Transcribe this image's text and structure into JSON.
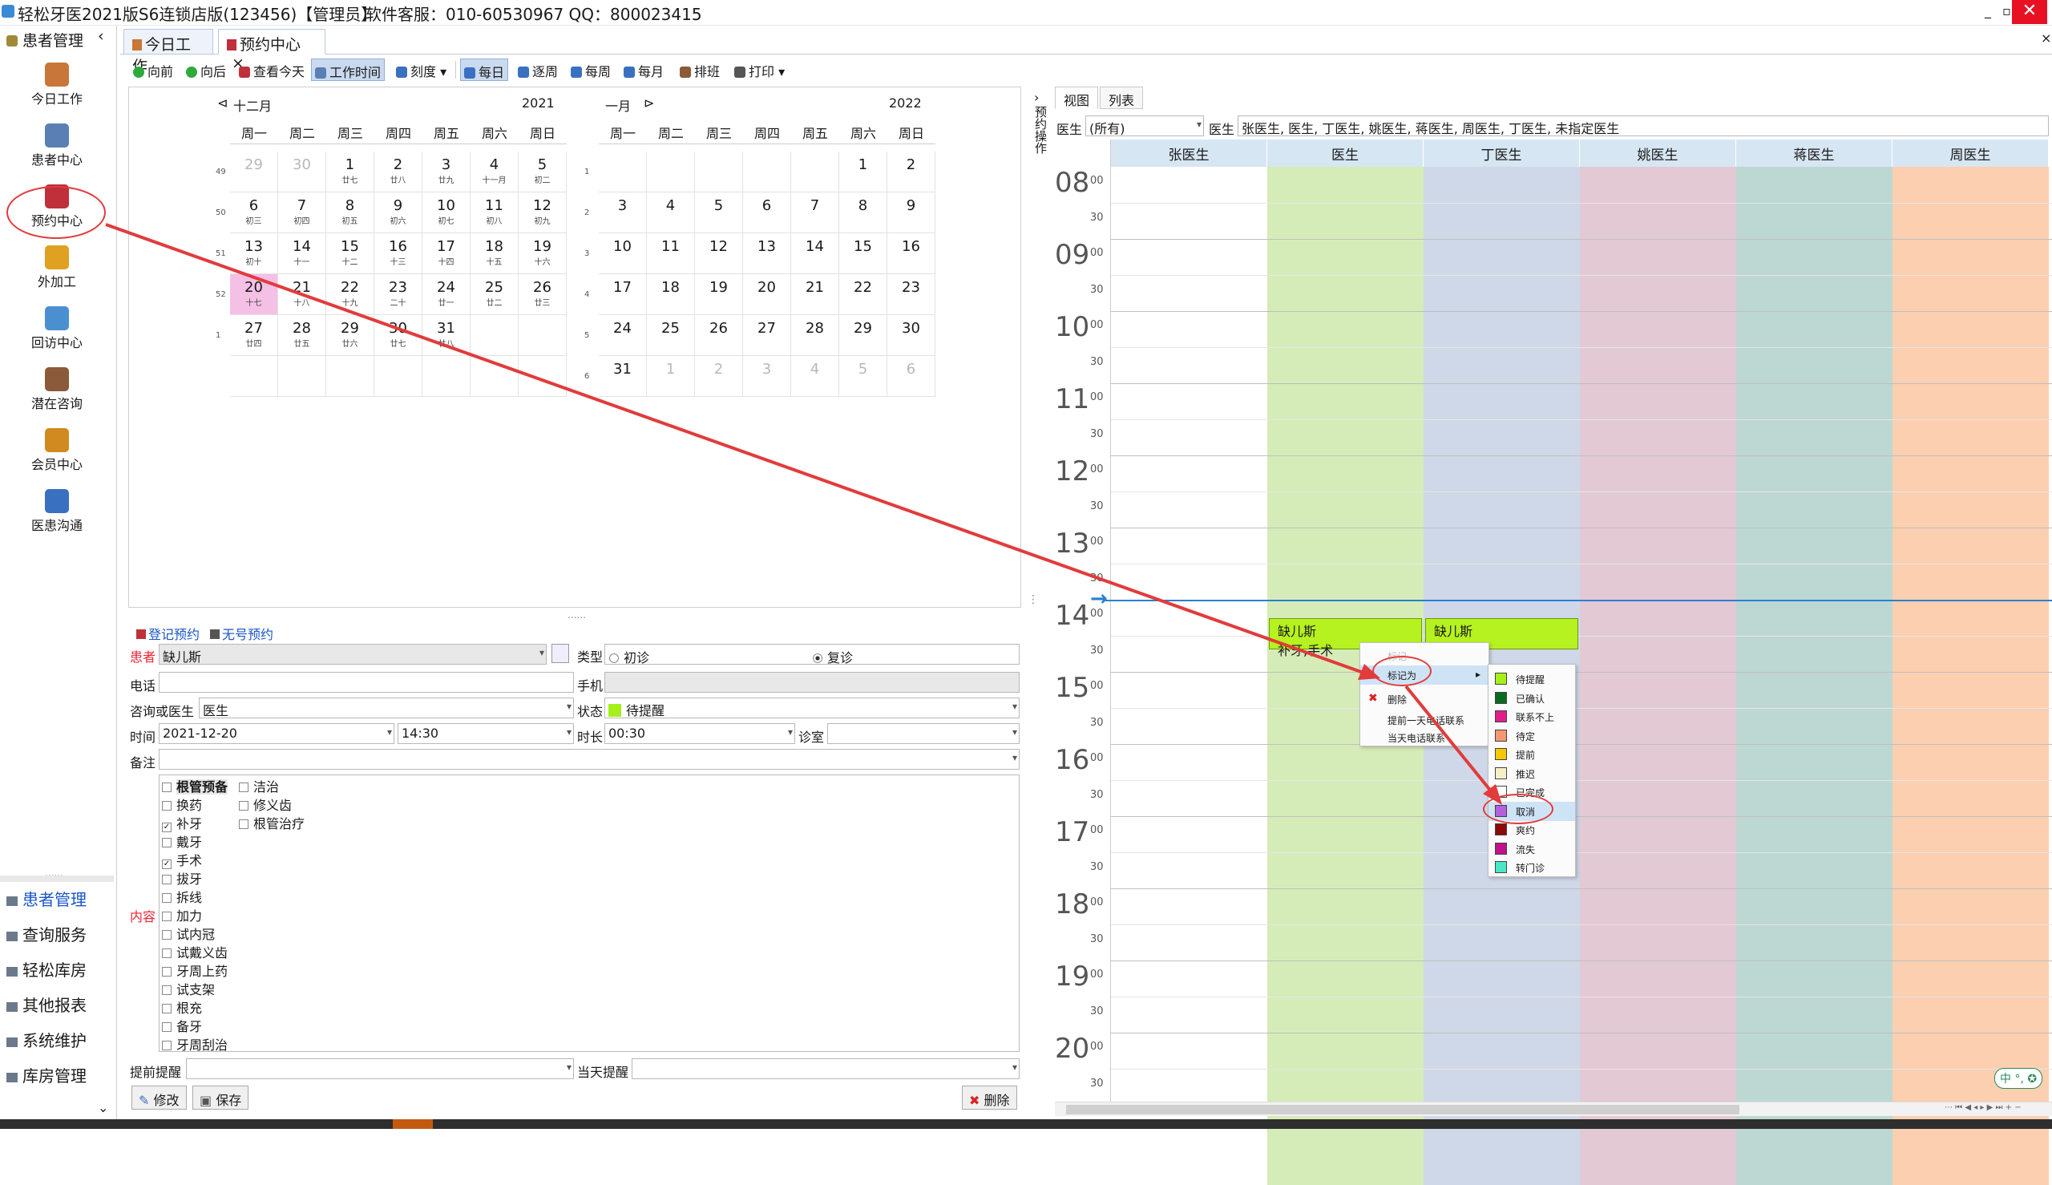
{
  "window": {
    "title": "轻松牙医2021版S6连锁店版(123456)【管理员】",
    "service": "软件客服：010-60530967 QQ：800023415",
    "controls": [
      "_",
      "▫",
      "✕"
    ]
  },
  "sidebar": {
    "header": "患者管理",
    "collapse": "‹",
    "items": [
      {
        "label": "今日工作",
        "icon": "doctor-icon",
        "color": "#c8763a"
      },
      {
        "label": "患者中心",
        "icon": "patients-icon",
        "color": "#5a7fb5"
      },
      {
        "label": "预约中心",
        "icon": "calendar-icon",
        "color": "#c0303a"
      },
      {
        "label": "外加工",
        "icon": "cubes-icon",
        "color": "#e0a020"
      },
      {
        "label": "回访中心",
        "icon": "refresh-icon",
        "color": "#4a90d0"
      },
      {
        "label": "潜在咨询",
        "icon": "consult-icon",
        "color": "#8a5a3a"
      },
      {
        "label": "会员中心",
        "icon": "members-icon",
        "color": "#d08a20"
      },
      {
        "label": "医患沟通",
        "icon": "film-icon",
        "color": "#3a70c0"
      }
    ],
    "grip": "......",
    "bottom": [
      {
        "label": "患者管理",
        "active": true
      },
      {
        "label": "查询服务"
      },
      {
        "label": "轻松库房"
      },
      {
        "label": "其他报表"
      },
      {
        "label": "系统维护"
      },
      {
        "label": "库房管理"
      }
    ],
    "more": "⌄"
  },
  "tabs": [
    {
      "label": "今日工作"
    },
    {
      "label": "预约中心",
      "close": "×"
    }
  ],
  "tabs_close": "×",
  "toolbar": [
    "向前",
    "向后",
    "查看今天",
    "工作时间",
    "刻度",
    "每日",
    "逐周",
    "每周",
    "每月",
    "排班",
    "打印"
  ],
  "calendar": {
    "months": [
      {
        "name": "十二月",
        "year": "2021",
        "prev": "⊲",
        "weeks": [
          "49",
          "50",
          "51",
          "52",
          "1",
          ""
        ],
        "days": [
          [
            [
              "29",
              "",
              1
            ],
            [
              "30",
              "",
              1
            ],
            [
              "1",
              "廿七"
            ],
            [
              "2",
              "廿八"
            ],
            [
              "3",
              "廿九"
            ],
            [
              "4",
              "十一月"
            ],
            [
              "5",
              "初二"
            ]
          ],
          [
            [
              "6",
              "初三"
            ],
            [
              "7",
              "初四"
            ],
            [
              "8",
              "初五"
            ],
            [
              "9",
              "初六"
            ],
            [
              "10",
              "初七"
            ],
            [
              "11",
              "初八"
            ],
            [
              "12",
              "初九"
            ]
          ],
          [
            [
              "13",
              "初十"
            ],
            [
              "14",
              "十一"
            ],
            [
              "15",
              "十二"
            ],
            [
              "16",
              "十三"
            ],
            [
              "17",
              "十四"
            ],
            [
              "18",
              "十五"
            ],
            [
              "19",
              "十六"
            ]
          ],
          [
            [
              "20",
              "十七",
              0,
              1
            ],
            [
              "21",
              "十八"
            ],
            [
              "22",
              "十九"
            ],
            [
              "23",
              "二十"
            ],
            [
              "24",
              "廿一"
            ],
            [
              "25",
              "廿二"
            ],
            [
              "26",
              "廿三"
            ]
          ],
          [
            [
              "27",
              "廿四"
            ],
            [
              "28",
              "廿五"
            ],
            [
              "29",
              "廿六"
            ],
            [
              "30",
              "廿七"
            ],
            [
              "31",
              "廿八"
            ],
            [
              "",
              ""
            ],
            [
              "",
              ""
            ]
          ],
          [
            [
              "",
              ""
            ],
            [
              "",
              ""
            ],
            [
              "",
              ""
            ],
            [
              "",
              ""
            ],
            [
              "",
              ""
            ],
            [
              "",
              ""
            ],
            [
              "",
              ""
            ]
          ]
        ]
      },
      {
        "name": "一月",
        "year": "2022",
        "next": "⊳",
        "weeks": [
          "1",
          "2",
          "3",
          "4",
          "5",
          "6"
        ],
        "days": [
          [
            [
              "",
              ""
            ],
            [
              "",
              ""
            ],
            [
              "",
              ""
            ],
            [
              "",
              ""
            ],
            [
              "",
              ""
            ],
            [
              "1",
              ""
            ],
            [
              "2",
              ""
            ]
          ],
          [
            [
              "3",
              ""
            ],
            [
              "4",
              ""
            ],
            [
              "5",
              ""
            ],
            [
              "6",
              ""
            ],
            [
              "7",
              ""
            ],
            [
              "8",
              ""
            ],
            [
              "9",
              ""
            ]
          ],
          [
            [
              "10",
              ""
            ],
            [
              "11",
              ""
            ],
            [
              "12",
              ""
            ],
            [
              "13",
              ""
            ],
            [
              "14",
              ""
            ],
            [
              "15",
              ""
            ],
            [
              "16",
              ""
            ]
          ],
          [
            [
              "17",
              ""
            ],
            [
              "18",
              ""
            ],
            [
              "19",
              ""
            ],
            [
              "20",
              ""
            ],
            [
              "21",
              ""
            ],
            [
              "22",
              ""
            ],
            [
              "23",
              ""
            ]
          ],
          [
            [
              "24",
              ""
            ],
            [
              "25",
              ""
            ],
            [
              "26",
              ""
            ],
            [
              "27",
              ""
            ],
            [
              "28",
              ""
            ],
            [
              "29",
              ""
            ],
            [
              "30",
              ""
            ]
          ],
          [
            [
              "31",
              ""
            ],
            [
              "1",
              "",
              1
            ],
            [
              "2",
              "",
              1
            ],
            [
              "3",
              "",
              1
            ],
            [
              "4",
              "",
              1
            ],
            [
              "5",
              "",
              1
            ],
            [
              "6",
              "",
              1
            ]
          ]
        ]
      }
    ],
    "weekdays": [
      "周一",
      "周二",
      "周三",
      "周四",
      "周五",
      "周六",
      "周日"
    ],
    "splitter": "......"
  },
  "form": {
    "tab1": "登记预约",
    "tab2": "无号预约",
    "patient_label": "患者",
    "patient": "缺儿斯",
    "type_label": "类型",
    "type_opt1": "初诊",
    "type_opt2": "复诊",
    "phone_label": "电话",
    "mobile_label": "手机",
    "doctor_label": "咨询或医生",
    "doctor": "医生",
    "status_label": "状态",
    "status": "待提醒",
    "status_color": "#a6f01a",
    "time_label": "时间",
    "date": "2021-12-20",
    "time": "14:30",
    "duration_label": "时长",
    "duration": "00:30",
    "room_label": "诊室",
    "note_label": "备注",
    "content_label": "内容",
    "items_col1": [
      [
        "根管预备",
        false
      ],
      [
        "换药",
        false
      ],
      [
        "补牙",
        true
      ],
      [
        "戴牙",
        false
      ],
      [
        "手术",
        true
      ],
      [
        "拔牙",
        false
      ],
      [
        "拆线",
        false
      ],
      [
        "加力",
        false
      ],
      [
        "试内冠",
        false
      ],
      [
        "试戴义齿",
        false
      ],
      [
        "牙周上药",
        false
      ],
      [
        "试支架",
        false
      ],
      [
        "根充",
        false
      ],
      [
        "备牙",
        false
      ],
      [
        "牙周刮治",
        false
      ]
    ],
    "items_col2": [
      [
        "洁治",
        false
      ],
      [
        "修义齿",
        false
      ],
      [
        "根管治疗",
        false
      ]
    ],
    "remind_label": "提前提醒",
    "today_remind_label": "当天提醒",
    "edit_btn": "修改",
    "save_btn": "保存",
    "delete_btn": "删除"
  },
  "vertical_tab": "预约操作",
  "vsplit": {
    "arrow": "›",
    "grip": "⋮"
  },
  "schedule": {
    "tabs": [
      "视图",
      "列表"
    ],
    "doctor_label": "医生",
    "doctor_filter": "(所有)",
    "doctor2_label": "医生",
    "doctors_list": "张医生, 医生, 丁医生, 姚医生, 蒋医生, 周医生, 丁医生, 未指定医生",
    "columns": [
      {
        "name": "张医生",
        "color": "#ffffff"
      },
      {
        "name": "医生",
        "color": "#d6ecb8"
      },
      {
        "name": "丁医生",
        "color": "#cfd8e8"
      },
      {
        "name": "姚医生",
        "color": "#e3c9d3"
      },
      {
        "name": "蒋医生",
        "color": "#bdd8d2"
      },
      {
        "name": "周医生",
        "color": "#fbcfb0"
      }
    ],
    "hours": [
      "08",
      "09",
      "10",
      "11",
      "12",
      "13",
      "14",
      "15",
      "16",
      "17",
      "18",
      "19",
      "20"
    ],
    "minutes_00": "00",
    "minutes_30": "30",
    "now_arrow": "→",
    "now_hours": 14.0,
    "appt1": {
      "line1": "缺儿斯",
      "line2": "补牙,手术",
      "start_hours": 14.25,
      "duration_hours": 0.5
    },
    "appt2": {
      "line1": "缺儿斯",
      "start_hours": 14.25,
      "duration_hours": 0.5
    },
    "scroll": "⋯ ⏮ ◀ ◂ ▸ ▶ ⏭ + −"
  },
  "context_menu": {
    "items": [
      {
        "label": "标记为",
        "hl": true,
        "arrow": "▸"
      },
      {
        "label": "删除",
        "icon": "✖"
      },
      {
        "label": "提前一天电话联系"
      },
      {
        "label": "当天电话联系"
      }
    ],
    "ghost": "标记"
  },
  "submenu": [
    {
      "label": "待提醒",
      "color": "#a6f01a"
    },
    {
      "label": "已确认",
      "color": "#0a6b20"
    },
    {
      "label": "联系不上",
      "color": "#e0208a"
    },
    {
      "label": "待定",
      "color": "#f59770"
    },
    {
      "label": "提前",
      "color": "#f7c800"
    },
    {
      "label": "推迟",
      "color": "#f6f0c8"
    },
    {
      "label": "已完成",
      "color": "#ffffff"
    },
    {
      "label": "取消",
      "color": "#b45fdd",
      "hl": true
    },
    {
      "label": "爽约",
      "color": "#8b0a0a"
    },
    {
      "label": "流失",
      "color": "#c0128a"
    },
    {
      "label": "转门诊",
      "color": "#4ae8c6"
    }
  ],
  "ime": "中 °, ✪"
}
